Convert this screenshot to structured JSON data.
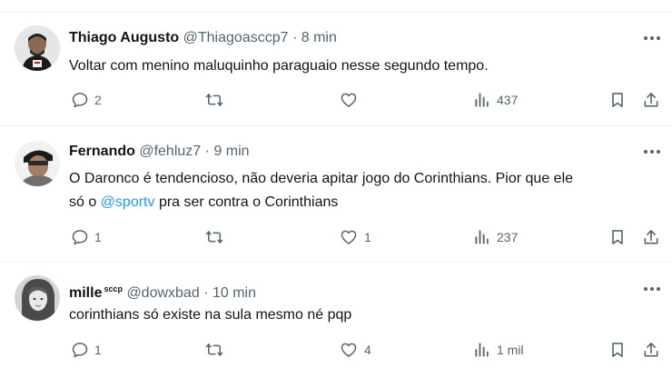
{
  "tweets": [
    {
      "name": "Thiago Augusto",
      "badge": "",
      "handle": "@Thiagoasccp7",
      "dot": "·",
      "time": "8 min",
      "text": "Voltar com menino maluquinho paraguaio nesse segundo tempo.",
      "replies": "2",
      "retweets": "",
      "likes": "",
      "views": "437"
    },
    {
      "name": "Fernando",
      "badge": "",
      "handle": "@fehluz7",
      "dot": "·",
      "time": "9 min",
      "text_line1": "O Daronco é tendencioso, não deveria apitar jogo do Corinthians. Pior que ele",
      "text_line2_pre": "só o ",
      "text_line2_mention": "@sportv",
      "text_line2_post": " pra ser contra o Corinthians",
      "replies": "1",
      "retweets": "",
      "likes": "1",
      "views": "237"
    },
    {
      "name": "mille",
      "badge": "sccp",
      "handle": "@dowxbad",
      "dot": "·",
      "time": "10 min",
      "text": "corinthians só existe na sula mesmo né pqp",
      "replies": "1",
      "retweets": "",
      "likes": "4",
      "views": "1 mil"
    }
  ],
  "icons": {
    "reply": "reply-icon",
    "retweet": "retweet-icon",
    "like": "heart-icon",
    "views": "views-icon",
    "bookmark": "bookmark-icon",
    "share": "share-icon",
    "more": "more-icon"
  },
  "colors": {
    "text": "#0f1419",
    "secondary": "#536471",
    "link": "#1d9bf0",
    "divider": "#eff3f4"
  }
}
